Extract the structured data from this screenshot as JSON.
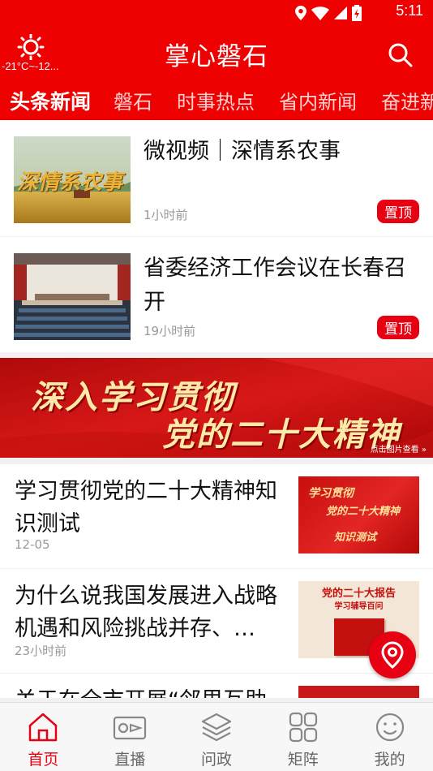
{
  "status_bar": {
    "time": "5:11"
  },
  "header": {
    "app_title": "掌心磐石",
    "weather_text": "-21°C~-12...",
    "weather_icon": "sun-icon",
    "search_icon": "search-icon"
  },
  "tabs": [
    {
      "label": "头条新闻",
      "active": true
    },
    {
      "label": "磐石"
    },
    {
      "label": "时事热点"
    },
    {
      "label": "省内新闻"
    },
    {
      "label": "奋进新"
    }
  ],
  "top_articles": [
    {
      "title": "微视频｜深情系农事",
      "time": "1小时前",
      "badge": "置顶",
      "thumb_text": "深情系农事"
    },
    {
      "title": "省委经济工作会议在长春召开",
      "time": "19小时前",
      "badge": "置顶"
    }
  ],
  "banner": {
    "line1": "深入学习贯彻",
    "line2": "党的二十大精神",
    "hint": "点击图片查看"
  },
  "articles": [
    {
      "title": "学习贯彻党的二十大精神知识测试",
      "time": "12-05",
      "thumb_line1": "学习贯彻",
      "thumb_line2": "党的二十大精神",
      "thumb_line3": "知识测试"
    },
    {
      "title": "为什么说我国发展进入战略机遇和风险挑战并存、…",
      "time": "23小时前",
      "thumb_line1": "党的二十大报告",
      "thumb_line2": "学习辅导百问"
    },
    {
      "title": "关于在全市开展“邻里互助",
      "time": ""
    }
  ],
  "bottom_nav": [
    {
      "label": "首页",
      "icon": "home-icon",
      "active": true
    },
    {
      "label": "直播",
      "icon": "video-camera-icon"
    },
    {
      "label": "问政",
      "icon": "layers-icon"
    },
    {
      "label": "矩阵",
      "icon": "grid-icon"
    },
    {
      "label": "我的",
      "icon": "smiley-icon"
    }
  ],
  "colors": {
    "brand_red": "#ee0000",
    "badge_red": "#e60012"
  }
}
